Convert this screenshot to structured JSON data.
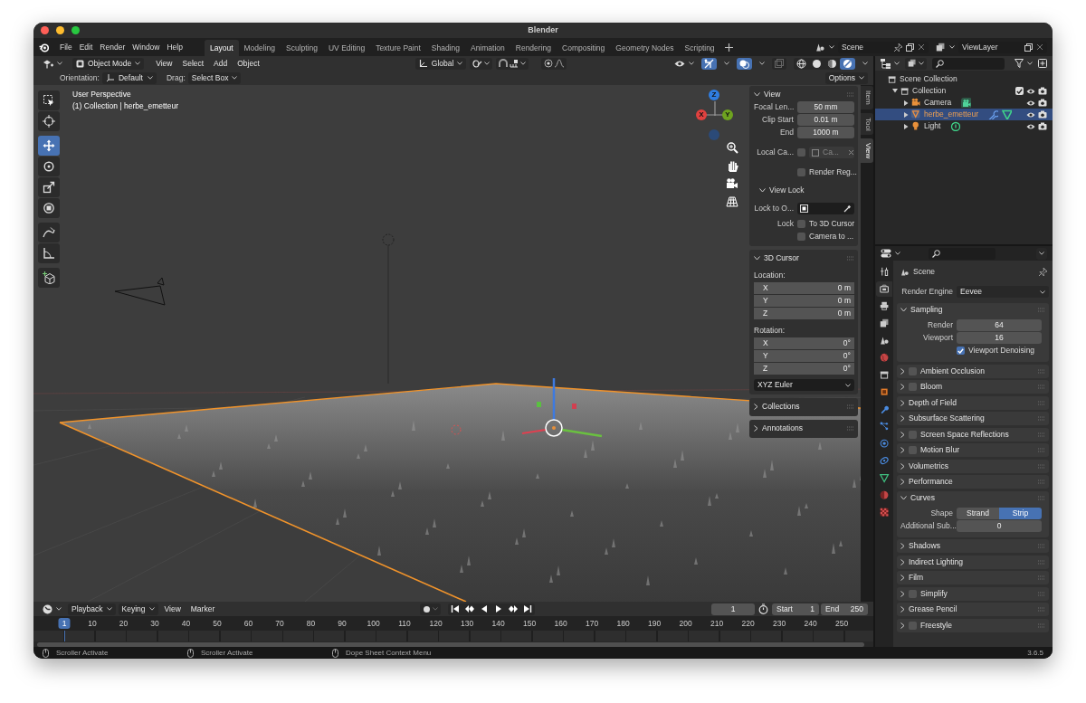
{
  "window": {
    "title": "Blender"
  },
  "menu": [
    "File",
    "Edit",
    "Render",
    "Window",
    "Help"
  ],
  "workspaces": [
    {
      "label": "Layout",
      "selected": true
    },
    {
      "label": "Modeling",
      "selected": false
    },
    {
      "label": "Sculpting",
      "selected": false
    },
    {
      "label": "UV Editing",
      "selected": false
    },
    {
      "label": "Texture Paint",
      "selected": false
    },
    {
      "label": "Shading",
      "selected": false
    },
    {
      "label": "Animation",
      "selected": false
    },
    {
      "label": "Rendering",
      "selected": false
    },
    {
      "label": "Compositing",
      "selected": false
    },
    {
      "label": "Geometry Nodes",
      "selected": false
    },
    {
      "label": "Scripting",
      "selected": false
    }
  ],
  "scene": "Scene",
  "view_layer": "ViewLayer",
  "viewport_header": {
    "mode": "Object Mode",
    "menus": [
      "View",
      "Select",
      "Add",
      "Object"
    ],
    "orientation": "Global",
    "show_gizmos": true,
    "show_overlays": true,
    "xray": false,
    "shading": [
      {
        "kind": "wireframe",
        "selected": false
      },
      {
        "kind": "solid",
        "selected": false
      },
      {
        "kind": "material",
        "selected": false
      },
      {
        "kind": "rendered",
        "selected": true
      }
    ]
  },
  "tool_settings": {
    "orientation_label": "Orientation:",
    "orientation": "Default",
    "drag_label": "Drag:",
    "drag": "Select Box",
    "options": "Options"
  },
  "viewport": {
    "info": [
      "User Perspective",
      "(1) Collection | herbe_emetteur"
    ],
    "axes": [
      "Z",
      "Y",
      "X"
    ]
  },
  "toolbar": [
    [
      {
        "kind": "select",
        "selected": false
      },
      {
        "kind": "cursor",
        "selected": false
      }
    ],
    [
      {
        "kind": "move",
        "selected": true
      },
      {
        "kind": "rotate",
        "selected": false
      },
      {
        "kind": "scale",
        "selected": false
      },
      {
        "kind": "transform",
        "selected": false
      }
    ],
    [
      {
        "kind": "annotate",
        "selected": false
      },
      {
        "kind": "measure",
        "selected": false
      }
    ],
    [
      {
        "kind": "add_cube",
        "selected": false
      }
    ]
  ],
  "sidebar_tabs": [
    {
      "label": "Item",
      "selected": false
    },
    {
      "label": "Tool",
      "selected": false
    },
    {
      "label": "View",
      "selected": true
    }
  ],
  "sidebar": {
    "panels": [
      {
        "title": "View",
        "expanded": true,
        "rows": [
          {
            "kind": "field",
            "label": "Focal Len...",
            "value": "50 mm"
          },
          {
            "kind": "field",
            "label": "Clip Start",
            "value": "0.01 m"
          },
          {
            "kind": "field",
            "label": "End",
            "value": "1000 m"
          },
          {
            "kind": "local_camera",
            "label": "Local Ca...",
            "checked": false,
            "value": "Ca...",
            "disabled": true
          },
          {
            "kind": "checkbox",
            "text": "Render Reg...",
            "checked": false
          },
          {
            "kind": "subpanel",
            "title": "View Lock",
            "expanded": true
          },
          {
            "kind": "picker",
            "label": "Lock to O..."
          },
          {
            "kind": "checkbox",
            "label": "Lock",
            "text": "To 3D Cursor",
            "checked": false
          },
          {
            "kind": "checkbox",
            "text": "Camera to ...",
            "checked": false
          }
        ]
      },
      {
        "title": "3D Cursor",
        "expanded": true,
        "rows": [
          {
            "kind": "caption",
            "text": "Location:"
          },
          {
            "kind": "vector",
            "items": [
              {
                "axis": "X",
                "value": "0 m"
              },
              {
                "axis": "Y",
                "value": "0 m"
              },
              {
                "axis": "Z",
                "value": "0 m"
              }
            ]
          },
          {
            "kind": "caption",
            "text": "Rotation:"
          },
          {
            "kind": "vector",
            "items": [
              {
                "axis": "X",
                "value": "0°"
              },
              {
                "axis": "Y",
                "value": "0°"
              },
              {
                "axis": "Z",
                "value": "0°"
              }
            ]
          },
          {
            "kind": "dropdown",
            "value": "XYZ Euler"
          }
        ]
      },
      {
        "title": "Collections",
        "expanded": false
      },
      {
        "title": "Annotations",
        "expanded": false
      }
    ]
  },
  "timeline": {
    "menus": [
      {
        "label": "Playback",
        "dropdown": true
      },
      {
        "label": "Keying",
        "dropdown": true
      },
      {
        "label": "View",
        "dropdown": false
      },
      {
        "label": "Marker",
        "dropdown": false
      }
    ],
    "current_frame": "1",
    "start_label": "Start",
    "start": "1",
    "end_label": "End",
    "end": "250",
    "playhead": "1",
    "ticks": [
      "10",
      "20",
      "30",
      "40",
      "50",
      "60",
      "70",
      "80",
      "90",
      "100",
      "110",
      "120",
      "130",
      "140",
      "150",
      "160",
      "170",
      "180",
      "190",
      "200",
      "210",
      "220",
      "230",
      "240",
      "250"
    ]
  },
  "outliner": {
    "root": "Scene Collection",
    "items": [
      {
        "label": "Collection",
        "kind": "collection",
        "checked": true,
        "expanded": true,
        "children": [
          {
            "label": "Camera",
            "kind": "camera",
            "selected": false
          },
          {
            "label": "herbe_emetteur",
            "kind": "mesh",
            "selected": true
          },
          {
            "label": "Light",
            "kind": "light",
            "selected": false
          }
        ]
      }
    ]
  },
  "properties": {
    "tabs": [
      {
        "kind": "tool",
        "selected": false
      },
      {
        "kind": "render",
        "selected": true
      },
      {
        "kind": "output",
        "selected": false
      },
      {
        "kind": "view_layer",
        "selected": false
      },
      {
        "kind": "scene",
        "selected": false
      },
      {
        "kind": "world",
        "selected": false
      },
      {
        "kind": "collection",
        "selected": false
      },
      {
        "kind": "object",
        "selected": false
      },
      {
        "kind": "modifiers",
        "selected": false
      },
      {
        "kind": "particles",
        "selected": false
      },
      {
        "kind": "physics",
        "selected": false
      },
      {
        "kind": "constraints",
        "selected": false
      },
      {
        "kind": "data",
        "selected": false
      },
      {
        "kind": "material",
        "selected": false
      },
      {
        "kind": "texture",
        "selected": false
      }
    ],
    "context": "Scene",
    "render_engine_label": "Render Engine",
    "render_engine": "Eevee",
    "panels": [
      {
        "title": "Sampling",
        "expanded": true,
        "rows": [
          {
            "kind": "number",
            "label": "Render",
            "value": "64"
          },
          {
            "kind": "number",
            "label": "Viewport",
            "value": "16"
          },
          {
            "kind": "checkbox",
            "text": "Viewport Denoising",
            "checked": true
          }
        ]
      },
      {
        "title": "Ambient Occlusion",
        "expanded": false,
        "checked": false
      },
      {
        "title": "Bloom",
        "expanded": false,
        "checked": false
      },
      {
        "title": "Depth of Field",
        "expanded": false
      },
      {
        "title": "Subsurface Scattering",
        "expanded": false
      },
      {
        "title": "Screen Space Reflections",
        "expanded": false,
        "checked": false
      },
      {
        "title": "Motion Blur",
        "expanded": false,
        "checked": false
      },
      {
        "title": "Volumetrics",
        "expanded": false
      },
      {
        "title": "Performance",
        "expanded": false
      },
      {
        "title": "Curves",
        "expanded": true,
        "rows": [
          {
            "kind": "segmented",
            "label": "Shape",
            "options": [
              {
                "label": "Strand",
                "selected": false
              },
              {
                "label": "Strip",
                "selected": true
              }
            ]
          },
          {
            "kind": "number",
            "label": "Additional Sub...",
            "value": "0"
          }
        ]
      },
      {
        "title": "Shadows",
        "expanded": false
      },
      {
        "title": "Indirect Lighting",
        "expanded": false
      },
      {
        "title": "Film",
        "expanded": false
      },
      {
        "title": "Simplify",
        "expanded": false,
        "checked": false
      },
      {
        "title": "Grease Pencil",
        "expanded": false
      },
      {
        "title": "Freestyle",
        "expanded": false,
        "checked": false
      }
    ]
  },
  "status_bar": {
    "hints": [
      "Scroller Activate",
      "Scroller Activate",
      "Dope Sheet Context Menu"
    ],
    "version": "3.6.5"
  }
}
